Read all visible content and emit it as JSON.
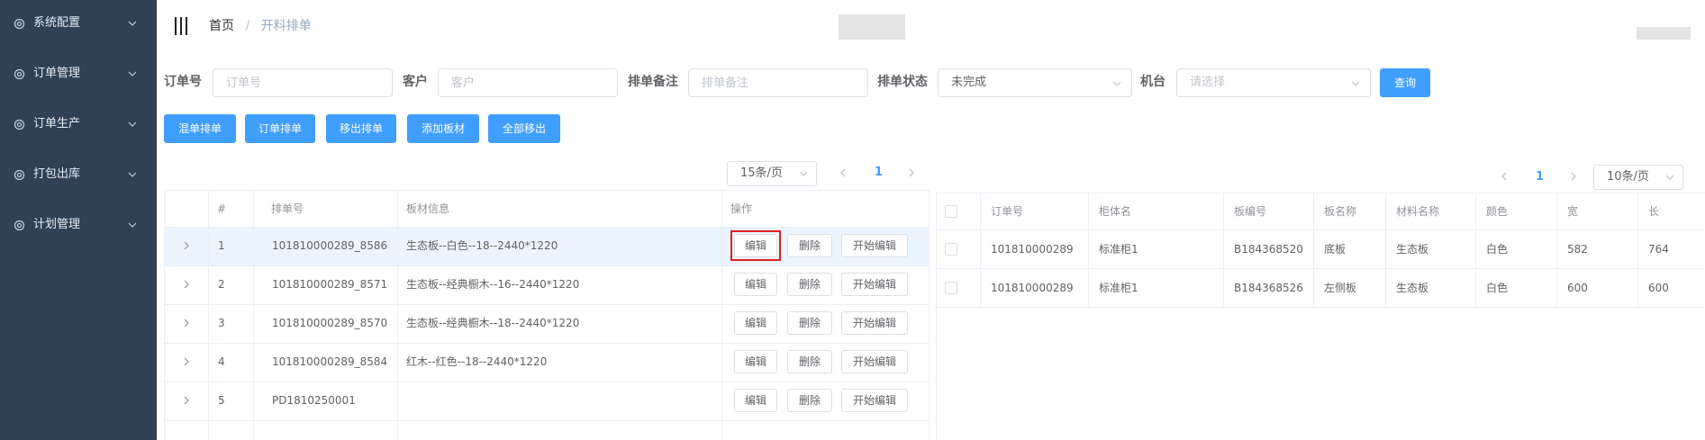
{
  "sidebar": {
    "items": [
      {
        "label": "系统配置"
      },
      {
        "label": "订单管理"
      },
      {
        "label": "订单生产"
      },
      {
        "label": "打包出库"
      },
      {
        "label": "计划管理"
      }
    ]
  },
  "breadcrumb": {
    "home": "首页",
    "separator": "/",
    "current": "开料排单"
  },
  "filters": {
    "order_no": {
      "label": "订单号",
      "placeholder": "订单号"
    },
    "customer": {
      "label": "客户",
      "placeholder": "客户"
    },
    "remark": {
      "label": "排单备注",
      "placeholder": "排单备注"
    },
    "status": {
      "label": "排单状态",
      "value": "未完成"
    },
    "machine": {
      "label": "机台",
      "placeholder": "请选择"
    },
    "query_label": "查询"
  },
  "actions": [
    {
      "label": "混单排单"
    },
    {
      "label": "订单排单"
    },
    {
      "label": "移出排单"
    },
    {
      "label": "添加板材"
    },
    {
      "label": "全部移出"
    }
  ],
  "left_pagination": {
    "page_size": "15条/页",
    "current_page": "1"
  },
  "right_pagination": {
    "page_size": "10条/页",
    "current_page": "1"
  },
  "left_table": {
    "headers": [
      "#",
      "排单号",
      "板材信息",
      "操作"
    ],
    "rows": [
      {
        "index": "1",
        "no": "101810000289_8586",
        "info": "生态板--白色--18--2440*1220"
      },
      {
        "index": "2",
        "no": "101810000289_8571",
        "info": "生态板--经典橱木--16--2440*1220"
      },
      {
        "index": "3",
        "no": "101810000289_8570",
        "info": "生态板--经典橱木--18--2440*1220"
      },
      {
        "index": "4",
        "no": "101810000289_8584",
        "info": "红木--红色--18--2440*1220"
      },
      {
        "index": "5",
        "no": "PD1810250001",
        "info": ""
      }
    ],
    "edit_label": "编辑",
    "delete_label": "删除",
    "start_edit_label": "开始编辑"
  },
  "right_table": {
    "headers": [
      "订单号",
      "柜体名",
      "板编号",
      "板名称",
      "材料名称",
      "颜色",
      "宽",
      "长"
    ],
    "rows": [
      {
        "order": "101810000289",
        "cabinet": "标准柜1",
        "board_no": "B184368520",
        "board_name": "底板",
        "material": "生态板",
        "color": "白色",
        "width": "582",
        "length": "764"
      },
      {
        "order": "101810000289",
        "cabinet": "标准柜1",
        "board_no": "B184368526",
        "board_name": "左侧板",
        "material": "生态板",
        "color": "白色",
        "width": "600",
        "length": "600"
      }
    ]
  },
  "colors": {
    "sidebar": "#304156",
    "primary": "#409eff",
    "highlight": "#e02020"
  }
}
